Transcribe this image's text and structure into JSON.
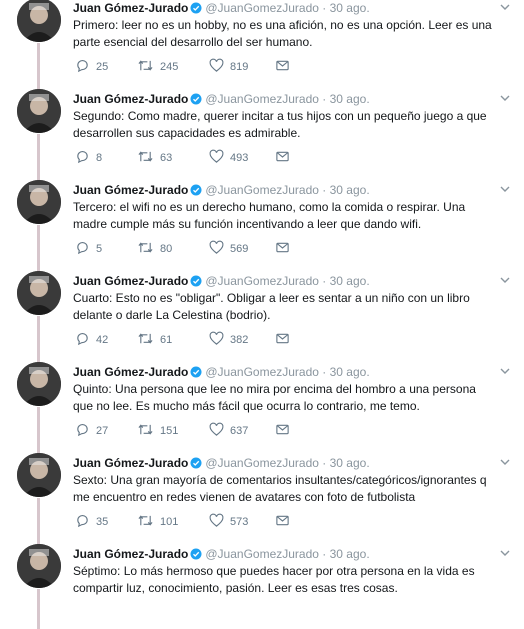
{
  "author": {
    "name": "Juan Gómez-Jurado",
    "handle": "@JuanGomezJurado",
    "separator": "·",
    "verified": true
  },
  "colors": {
    "verified": "#1da1f2",
    "icon": "#657786",
    "thread_line": "#d7c6cc",
    "meta": "#8a959e"
  },
  "icons": {
    "reply": "speech-bubble-icon",
    "retweet": "retweet-arrows-icon",
    "like": "heart-icon",
    "message": "envelope-icon",
    "menu": "chevron-down-icon",
    "verified": "verified-badge-icon"
  },
  "tweets": [
    {
      "date": "30 ago.",
      "text": "Primero: leer no es un hobby, no es una afición, no es una opción. Leer es una parte esencial del desarrollo del ser humano.",
      "replies": "25",
      "retweets": "245",
      "likes": "819"
    },
    {
      "date": "30 ago.",
      "text": "Segundo: Como madre, querer incitar a tus hijos con un pequeño juego a que desarrollen sus capacidades es admirable.",
      "replies": "8",
      "retweets": "63",
      "likes": "493"
    },
    {
      "date": "30 ago.",
      "text": "Tercero: el wifi no es un derecho humano, como la comida o respirar. Una madre cumple más su función incentivando a leer que dando wifi.",
      "replies": "5",
      "retweets": "80",
      "likes": "569"
    },
    {
      "date": "30 ago.",
      "text": "Cuarto: Esto no es \"obligar\". Obligar a leer es sentar a un niño con un libro delante o darle La Celestina (bodrio).",
      "replies": "42",
      "retweets": "61",
      "likes": "382"
    },
    {
      "date": "30 ago.",
      "text": "Quinto: Una persona que lee no mira por encima del hombro a una persona que no lee. Es mucho más fácil que ocurra lo contrario, me temo.",
      "replies": "27",
      "retweets": "151",
      "likes": "637"
    },
    {
      "date": "30 ago.",
      "text": "Sexto: Una gran mayoría de comentarios insultantes/categóricos/ignorantes q me encuentro en redes vienen de avatares con foto de futbolista",
      "replies": "35",
      "retweets": "101",
      "likes": "573"
    },
    {
      "date": "30 ago.",
      "text": "Séptimo: Lo más hermoso que puedes hacer por otra persona en la vida es compartir luz, conocimiento, pasión. Leer es esas tres cosas.",
      "replies": "",
      "retweets": "",
      "likes": ""
    }
  ]
}
